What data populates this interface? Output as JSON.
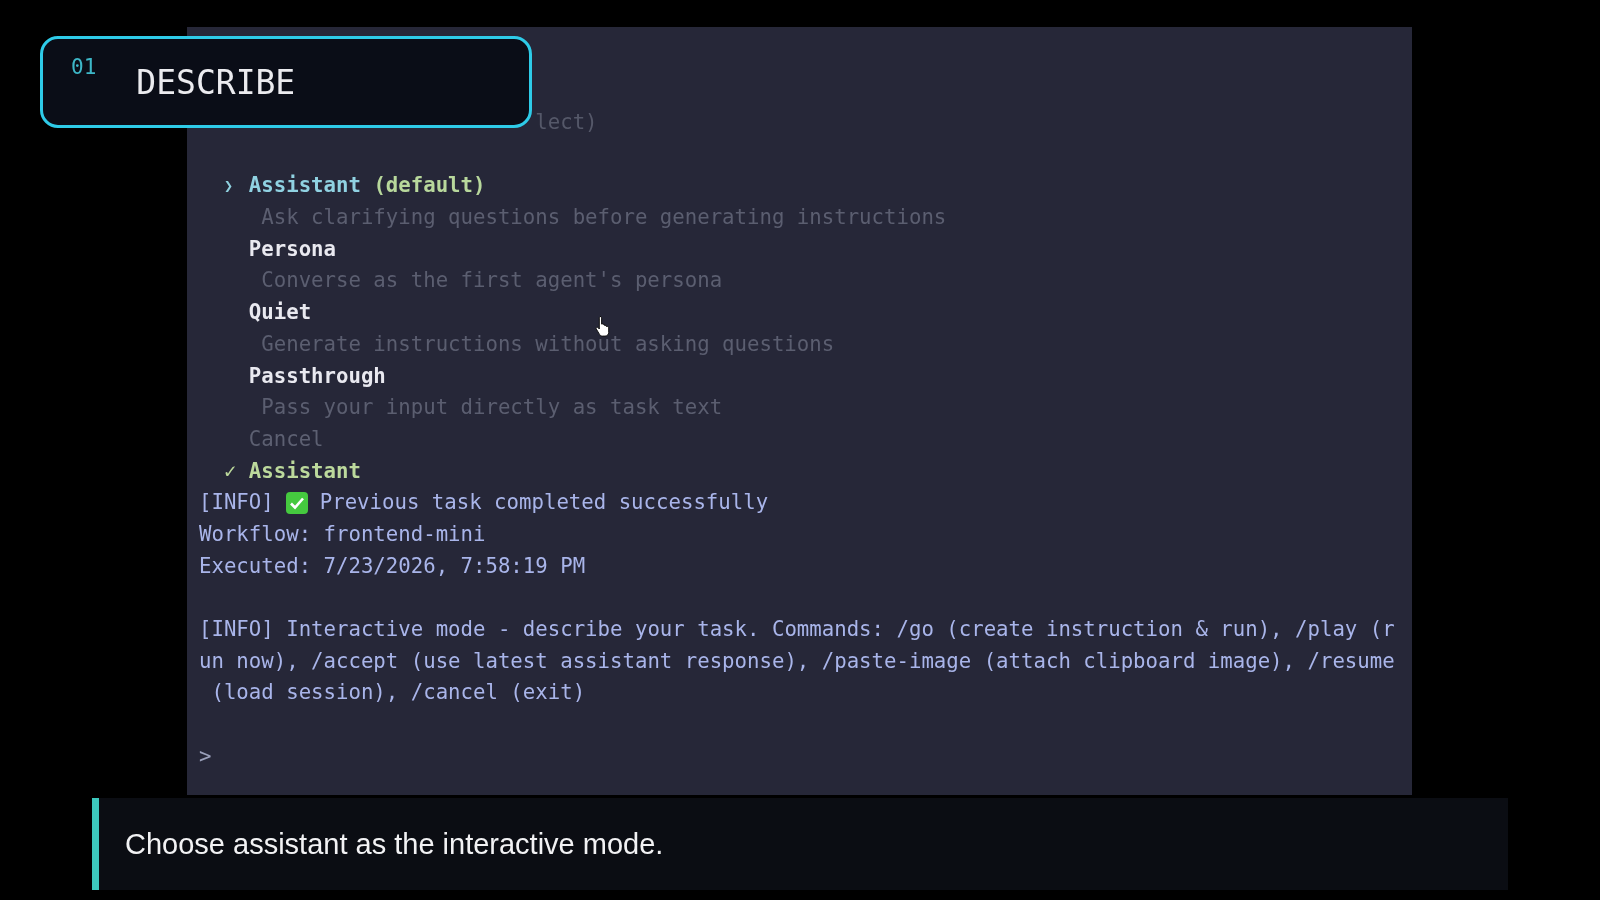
{
  "banner": {
    "number": "01",
    "title": "DESCRIBE"
  },
  "terminal": {
    "hint_fragment": "lect)",
    "menu": {
      "pointer": "❯",
      "options": [
        {
          "kind": "option",
          "label": "Assistant",
          "tag": "(default)",
          "description": "Ask clarifying questions before generating instructions",
          "selected": true
        },
        {
          "kind": "option",
          "label": "Persona",
          "description": "Converse as the first agent's persona",
          "selected": false
        },
        {
          "kind": "option",
          "label": "Quiet",
          "description": "Generate instructions without asking questions",
          "selected": false
        },
        {
          "kind": "option",
          "label": "Passthrough",
          "description": "Pass your input directly as task text",
          "selected": false
        },
        {
          "kind": "cancel",
          "label": "Cancel",
          "selected": false
        }
      ]
    },
    "result": {
      "mark": "✓",
      "label": "Assistant"
    },
    "status": {
      "prefix": "[INFO]",
      "text": "Previous task completed successfully"
    },
    "details": [
      "Workflow: frontend-mini",
      "Executed: 7/23/2026, 7:58:19 PM"
    ],
    "info_message": [
      "[INFO] Interactive mode - describe your task. Commands: /go (create instruction & run), /play (r",
      "un now), /accept (use latest assistant response), /paste-image (attach clipboard image), /resume",
      " (load session), /cancel (exit)"
    ],
    "prompt": ">"
  },
  "caption": "Choose assistant as the interactive mode."
}
